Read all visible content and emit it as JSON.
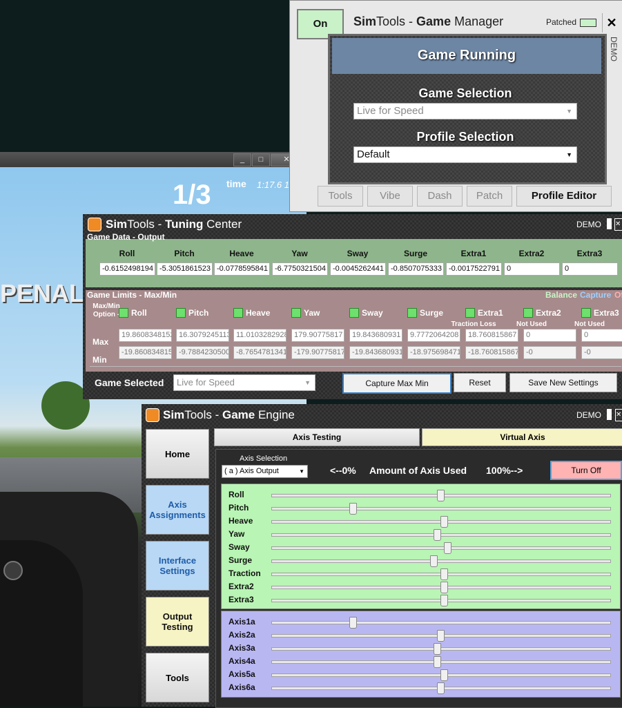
{
  "game_window": {
    "window_buttons": [
      "_",
      "□",
      "✕"
    ],
    "lap": "1/3",
    "time_label": "time",
    "time_value": "1:17.6 1",
    "penalty_text": "PENALT"
  },
  "game_manager": {
    "on_button": "On",
    "title_brand": "Sim",
    "title_rest": "Tools - ",
    "title_bold": "Game",
    "title_end": " Manager",
    "patched_label": "Patched",
    "close": "✕",
    "demo": "DEMO",
    "status": "Game Running",
    "game_selection_label": "Game Selection",
    "game_selection_value": "Live for Speed",
    "profile_selection_label": "Profile Selection",
    "profile_selection_value": "Default",
    "tabs": [
      "Tools",
      "Vibe",
      "Dash",
      "Patch"
    ],
    "profile_editor": "Profile Editor"
  },
  "tuning_center": {
    "title_brand": "Sim",
    "title_rest": "Tools - ",
    "title_bold": "Tuning",
    "title_end": " Center",
    "demo": "DEMO",
    "game_data_label": "Game Data - Output",
    "axes": [
      "Roll",
      "Pitch",
      "Heave",
      "Yaw",
      "Sway",
      "Surge",
      "Extra1",
      "Extra2",
      "Extra3"
    ],
    "outputs": [
      "-0.6152498194",
      "-5.3051861523",
      "-0.0778595841",
      "-6.7750321504",
      "-0.0045262441",
      "-0.8507075333",
      "-0.0017522791",
      "0",
      "0"
    ],
    "limits_label": "Game Limits - Max/Min",
    "balance_label": "Balance",
    "capture_label": "Capture",
    "of_label": "Of",
    "maxmin_option": "Max/Min Option -",
    "sublabels": [
      "",
      "",
      "",
      "",
      "",
      "",
      "Traction Loss",
      "Not Used",
      "Not Used"
    ],
    "max_label": "Max",
    "min_label": "Min",
    "max_values": [
      "19.8608348152",
      "16.3079245113",
      "11.0103282928",
      "179.90775817",
      "19.843680931",
      "9.7772064208",
      "18.760815867",
      "0",
      "0"
    ],
    "min_values": [
      "-19.860834815",
      "-9.7884230500",
      "-8.7654781341",
      "-179.90775817",
      "-19.843680931",
      "-18.975698471",
      "-18.760815867",
      "-0",
      "-0"
    ],
    "game_selected_label": "Game Selected",
    "game_selected_value": "Live for Speed",
    "capture_button": "Capture Max Min",
    "reset_button": "Reset",
    "save_button": "Save New Settings"
  },
  "game_engine": {
    "title_brand": "Sim",
    "title_rest": "Tools - ",
    "title_bold": "Game",
    "title_end": " Engine",
    "demo": "DEMO",
    "nav": [
      "Home",
      "Axis Assignments",
      "Interface Settings",
      "Output Testing",
      "Tools"
    ],
    "tab_axis_testing": "Axis Testing",
    "tab_virtual_axis": "Virtual Axis",
    "axis_selection_label": "Axis Selection",
    "axis_selection_value": "( a ) Axis Output",
    "range_left": "<--0%",
    "range_label": "Amount of Axis Used",
    "range_right": "100%-->",
    "turn_off": "Turn Off",
    "green_sliders": [
      {
        "label": "Roll",
        "value": 0.5
      },
      {
        "label": "Pitch",
        "value": 0.24
      },
      {
        "label": "Heave",
        "value": 0.51
      },
      {
        "label": "Yaw",
        "value": 0.49
      },
      {
        "label": "Sway",
        "value": 0.52
      },
      {
        "label": "Surge",
        "value": 0.48
      },
      {
        "label": "Traction",
        "value": 0.51
      },
      {
        "label": "Extra2",
        "value": 0.51
      },
      {
        "label": "Extra3",
        "value": 0.51
      }
    ],
    "purple_sliders": [
      {
        "label": "Axis1a",
        "value": 0.24
      },
      {
        "label": "Axis2a",
        "value": 0.5
      },
      {
        "label": "Axis3a",
        "value": 0.49
      },
      {
        "label": "Axis4a",
        "value": 0.49
      },
      {
        "label": "Axis5a",
        "value": 0.51
      },
      {
        "label": "Axis6a",
        "value": 0.5
      }
    ]
  },
  "colors": {
    "green_panel": "#b9f5b4",
    "purple_panel": "#b9b7f2",
    "turn_off_bg": "#ffb3b3",
    "virtual_axis_bg": "#f6f3c4",
    "nav_blue": "#b8d8f5",
    "nav_yellow": "#f6f3c4"
  }
}
